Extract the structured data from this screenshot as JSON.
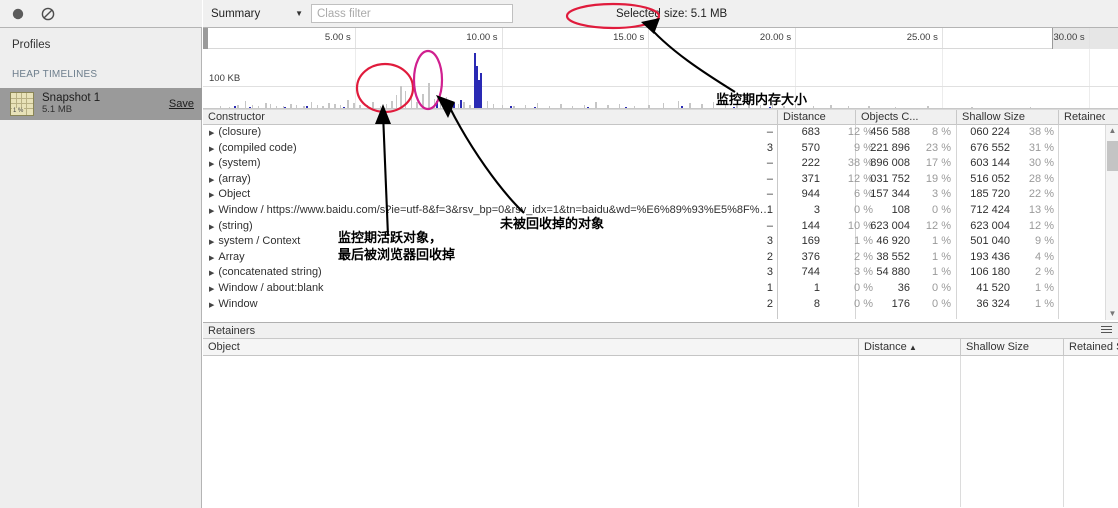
{
  "left_panel": {
    "toolbar": {
      "record_icon": "record-circle-icon",
      "clear_icon": "clear-prohibited-icon"
    },
    "profiles_label": "Profiles",
    "section_label": "HEAP TIMELINES",
    "snapshot": {
      "title": "Snapshot 1",
      "size": "5.1 MB",
      "save_label": "Save",
      "icon_badge": "1 %"
    }
  },
  "toolbar": {
    "view_label": "Summary",
    "dropdown_icon": "chevron-down-icon",
    "filter_placeholder": "Class filter",
    "filter_value": "",
    "selected_size": "Selected size: 5.1 MB"
  },
  "timeline": {
    "ticks": [
      "5.00 s",
      "10.00 s",
      "15.00 s",
      "20.00 s",
      "25.00 s",
      "30.00 s"
    ],
    "y_axis_label": "100 KB"
  },
  "annotations": [
    {
      "text": "监控期内存大小"
    },
    {
      "text": "未被回收掉的对象"
    },
    {
      "text": "监控期活跃对象，\n最后被浏览器回收掉"
    }
  ],
  "constructor_table": {
    "columns": [
      {
        "label": "Constructor",
        "sort": ""
      },
      {
        "label": "Distance",
        "sort": ""
      },
      {
        "label": "Objects C...",
        "sort": ""
      },
      {
        "label": "Shallow Size",
        "sort": ""
      },
      {
        "label": "Retained Size",
        "sort": "▼"
      }
    ],
    "rows": [
      {
        "name": "(closure)",
        "distance": "–",
        "objects": "683",
        "objects_pct": "12 %",
        "shallow": "456 588",
        "shallow_pct": "8 %",
        "retained": "060 224",
        "retained_pct": "38 %"
      },
      {
        "name": "(compiled code)",
        "distance": "3",
        "objects": "570",
        "objects_pct": "9 %",
        "shallow": "221 896",
        "shallow_pct": "23 %",
        "retained": "676 552",
        "retained_pct": "31 %"
      },
      {
        "name": "(system)",
        "distance": "–",
        "objects": "222",
        "objects_pct": "38 %",
        "shallow": "896 008",
        "shallow_pct": "17 %",
        "retained": "603 144",
        "retained_pct": "30 %"
      },
      {
        "name": "(array)",
        "distance": "–",
        "objects": "371",
        "objects_pct": "12 %",
        "shallow": "031 752",
        "shallow_pct": "19 %",
        "retained": "516 052",
        "retained_pct": "28 %"
      },
      {
        "name": "Object",
        "distance": "–",
        "objects": "944",
        "objects_pct": "6 %",
        "shallow": "157 344",
        "shallow_pct": "3 %",
        "retained": "185 720",
        "retained_pct": "22 %"
      },
      {
        "name": "Window / https://www.baidu.com/s?ie=utf-8&f=3&rsv_bp=0&rsv_idx=1&tn=baidu&wd=%E6%89%93%E5%8F%…",
        "distance": "1",
        "objects": "3",
        "objects_pct": "0 %",
        "shallow": "108",
        "shallow_pct": "0 %",
        "retained": "712 424",
        "retained_pct": "13 %"
      },
      {
        "name": "(string)",
        "distance": "–",
        "objects": "144",
        "objects_pct": "10 %",
        "shallow": "623 004",
        "shallow_pct": "12 %",
        "retained": "623 004",
        "retained_pct": "12 %"
      },
      {
        "name": "system / Context",
        "distance": "3",
        "objects": "169",
        "objects_pct": "1 %",
        "shallow": "46 920",
        "shallow_pct": "1 %",
        "retained": "501 040",
        "retained_pct": "9 %"
      },
      {
        "name": "Array",
        "distance": "2",
        "objects": "376",
        "objects_pct": "2 %",
        "shallow": "38 552",
        "shallow_pct": "1 %",
        "retained": "193 436",
        "retained_pct": "4 %"
      },
      {
        "name": "(concatenated string)",
        "distance": "3",
        "objects": "744",
        "objects_pct": "3 %",
        "shallow": "54 880",
        "shallow_pct": "1 %",
        "retained": "106 180",
        "retained_pct": "2 %"
      },
      {
        "name": "Window / about:blank",
        "distance": "1",
        "objects": "1",
        "objects_pct": "0 %",
        "shallow": "36",
        "shallow_pct": "0 %",
        "retained": "41 520",
        "retained_pct": "1 %"
      },
      {
        "name": "Window",
        "distance": "2",
        "objects": "8",
        "objects_pct": "0 %",
        "shallow": "176",
        "shallow_pct": "0 %",
        "retained": "36 324",
        "retained_pct": "1 %"
      }
    ]
  },
  "retainers": {
    "title": "Retainers",
    "menu_icon": "hamburger-menu-icon",
    "columns": [
      {
        "label": "Object",
        "sort": ""
      },
      {
        "label": "Distance",
        "sort": "▲"
      },
      {
        "label": "Shallow Size",
        "sort": ""
      },
      {
        "label": "Retained Size",
        "sort": ""
      }
    ],
    "rows": []
  },
  "chart_data": {
    "type": "bar",
    "title": "",
    "xlabel": "",
    "ylabel": "100 KB",
    "xlim": [
      0,
      31
    ],
    "ylim": [
      0,
      260
    ],
    "grid": true,
    "gridline_value": 100,
    "legend": [],
    "series": [
      {
        "name": "released (gray)",
        "color": "#c6c6c6",
        "points": [
          [
            0.4,
            8
          ],
          [
            0.7,
            5
          ],
          [
            1.0,
            14
          ],
          [
            1.25,
            30
          ],
          [
            1.5,
            12
          ],
          [
            1.7,
            9
          ],
          [
            1.95,
            22
          ],
          [
            2.1,
            16
          ],
          [
            2.3,
            10
          ],
          [
            2.55,
            7
          ],
          [
            2.8,
            18
          ],
          [
            3.0,
            12
          ],
          [
            3.25,
            9
          ],
          [
            3.5,
            26
          ],
          [
            3.7,
            14
          ],
          [
            3.9,
            10
          ],
          [
            4.1,
            21
          ],
          [
            4.3,
            16
          ],
          [
            4.5,
            12
          ],
          [
            4.75,
            34
          ],
          [
            4.95,
            20
          ],
          [
            5.15,
            15
          ],
          [
            5.4,
            11
          ],
          [
            5.6,
            24
          ],
          [
            5.85,
            9
          ],
          [
            6.05,
            18
          ],
          [
            6.25,
            30
          ],
          [
            6.4,
            55
          ],
          [
            6.55,
            95
          ],
          [
            6.7,
            72
          ],
          [
            6.9,
            44
          ],
          [
            7.1,
            26
          ],
          [
            7.3,
            60
          ],
          [
            7.5,
            110
          ],
          [
            7.7,
            38
          ],
          [
            7.9,
            22
          ],
          [
            8.1,
            48
          ],
          [
            8.3,
            30
          ],
          [
            8.5,
            16
          ],
          [
            8.7,
            26
          ],
          [
            8.9,
            14
          ],
          [
            9.1,
            120
          ],
          [
            9.3,
            52
          ],
          [
            9.5,
            30
          ],
          [
            9.7,
            18
          ],
          [
            10.0,
            12
          ],
          [
            10.4,
            9
          ],
          [
            10.8,
            14
          ],
          [
            11.2,
            22
          ],
          [
            11.6,
            10
          ],
          [
            12.0,
            18
          ],
          [
            12.4,
            8
          ],
          [
            12.8,
            13
          ],
          [
            13.2,
            26
          ],
          [
            13.6,
            11
          ],
          [
            14.0,
            16
          ],
          [
            14.5,
            9
          ],
          [
            15.0,
            12
          ],
          [
            15.5,
            20
          ],
          [
            16.0,
            30
          ],
          [
            16.4,
            22
          ],
          [
            16.8,
            17
          ],
          [
            17.2,
            26
          ],
          [
            17.6,
            12
          ],
          [
            18.0,
            19
          ],
          [
            18.4,
            28
          ],
          [
            18.8,
            14
          ],
          [
            19.2,
            22
          ],
          [
            19.6,
            10
          ],
          [
            20.0,
            16
          ],
          [
            20.6,
            9
          ],
          [
            21.2,
            12
          ],
          [
            21.8,
            7
          ],
          [
            22.5,
            10
          ],
          [
            23.4,
            6
          ],
          [
            24.5,
            8
          ],
          [
            26.0,
            5
          ],
          [
            28.0,
            4
          ]
        ]
      },
      {
        "name": "retained (blue)",
        "color": "#2a2ab4",
        "points": [
          [
            0.9,
            10
          ],
          [
            1.4,
            6
          ],
          [
            2.6,
            5
          ],
          [
            3.35,
            7
          ],
          [
            4.6,
            5
          ],
          [
            7.75,
            30
          ],
          [
            8.05,
            26
          ],
          [
            8.35,
            20
          ],
          [
            8.6,
            34
          ],
          [
            9.05,
            240
          ],
          [
            9.12,
            180
          ],
          [
            9.2,
            120
          ],
          [
            9.28,
            150
          ],
          [
            10.3,
            8
          ],
          [
            11.1,
            6
          ],
          [
            12.9,
            5
          ],
          [
            14.2,
            6
          ],
          [
            16.1,
            7
          ],
          [
            17.9,
            5
          ],
          [
            19.1,
            6
          ]
        ]
      }
    ]
  }
}
